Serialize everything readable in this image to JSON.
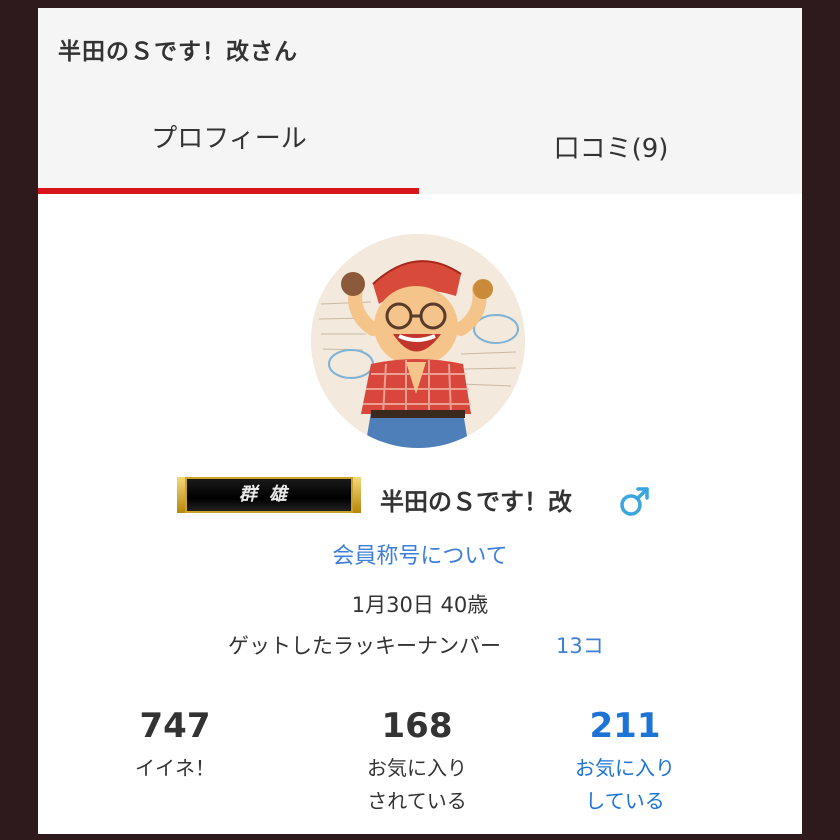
{
  "header": {
    "title": "半田のＳです！改さん"
  },
  "tabs": [
    {
      "label": "プロフィール",
      "active": true
    },
    {
      "label": "口コミ(9)",
      "active": false
    }
  ],
  "profile": {
    "rank_badge": "群雄",
    "username": "半田のＳです！改",
    "gender_icon": "male-icon",
    "title_link": "会員称号について",
    "birth_age": "1月30日 40歳",
    "lucky_label": "ゲットしたラッキーナンバー",
    "lucky_count": "13コ"
  },
  "stats": [
    {
      "value": "747",
      "label_line1": "イイネ！",
      "label_line2": ""
    },
    {
      "value": "168",
      "label_line1": "お気に入り",
      "label_line2": "されている"
    },
    {
      "value": "211",
      "label_line1": "お気に入り",
      "label_line2": "している"
    }
  ],
  "colors": {
    "accent_red": "#d8151b",
    "link_blue": "#3d7fd6",
    "stat_blue": "#1e73d6",
    "male_icon": "#39a6e0"
  }
}
